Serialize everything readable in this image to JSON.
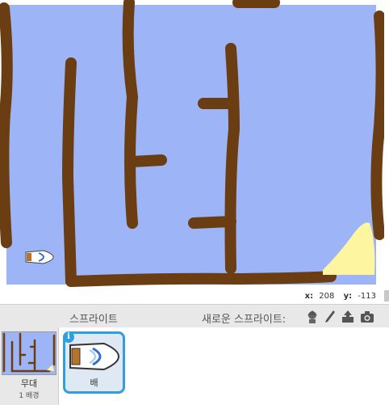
{
  "stage": {
    "background_color": "#9db4f6",
    "wall_color": "#6b3d12",
    "sand_color": "#fef5a0"
  },
  "coords": {
    "x_label": "x:",
    "x_value": "208",
    "y_label": "y:",
    "y_value": "-113"
  },
  "sprite_pane": {
    "sprites_label": "스프라이트",
    "new_sprite_label": "새로운 스프라이트:",
    "tools": [
      "sprite-library-icon",
      "paint-brush-icon",
      "upload-icon",
      "camera-icon"
    ]
  },
  "stage_thumbnail": {
    "name": "무대",
    "backgrounds": "1 배경"
  },
  "sprites": [
    {
      "name": "배",
      "info_icon": "i",
      "selected": true
    }
  ]
}
